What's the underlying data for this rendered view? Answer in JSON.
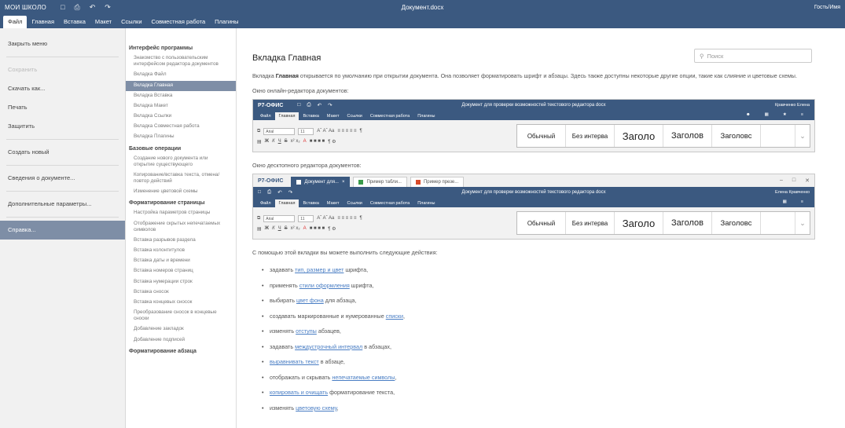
{
  "titlebar": {
    "app_name": "МОИ ШКОЛО",
    "doc_title": "Документ.docx",
    "user": "Гость/Имя"
  },
  "tabs": [
    "Файл",
    "Главная",
    "Вставка",
    "Макет",
    "Ссылки",
    "Совместная работа",
    "Плагины"
  ],
  "left_menu": [
    {
      "label": "Закрыть меню",
      "state": "normal"
    },
    {
      "label": "Сохранить",
      "state": "disabled"
    },
    {
      "label": "Скачать как...",
      "state": "normal"
    },
    {
      "label": "Печать",
      "state": "normal"
    },
    {
      "label": "Защитить",
      "state": "normal"
    },
    {
      "label": "Создать новый",
      "state": "normal"
    },
    {
      "label": "Сведения о документе...",
      "state": "normal"
    },
    {
      "label": "Дополнительные параметры...",
      "state": "normal"
    },
    {
      "label": "Справка...",
      "state": "active"
    }
  ],
  "toc": {
    "sections": [
      {
        "title": "Интерфейс программы",
        "items": [
          {
            "label": "Знакомство с пользовательским интерфейсом редактора документов",
            "active": false
          },
          {
            "label": "Вкладка Файл",
            "active": false
          },
          {
            "label": "Вкладка Главная",
            "active": true
          },
          {
            "label": "Вкладка Вставка",
            "active": false
          },
          {
            "label": "Вкладка Макет",
            "active": false
          },
          {
            "label": "Вкладка Ссылки",
            "active": false
          },
          {
            "label": "Вкладка Совместная работа",
            "active": false
          },
          {
            "label": "Вкладка Плагины",
            "active": false
          }
        ]
      },
      {
        "title": "Базовые операции",
        "items": [
          {
            "label": "Создание нового документа или открытие существующего",
            "active": false
          },
          {
            "label": "Копирование/вставка текста, отмена/повтор действий",
            "active": false
          },
          {
            "label": "Изменение цветовой схемы",
            "active": false
          }
        ]
      },
      {
        "title": "Форматирование страницы",
        "items": [
          {
            "label": "Настройка параметров страницы",
            "active": false
          },
          {
            "label": "Отображение скрытых непечатаемых символов",
            "active": false
          },
          {
            "label": "Вставка разрывов раздела",
            "active": false
          },
          {
            "label": "Вставка колонтитулов",
            "active": false
          },
          {
            "label": "Вставка даты и времени",
            "active": false
          },
          {
            "label": "Вставка номеров страниц",
            "active": false
          },
          {
            "label": "Вставка нумерации строк",
            "active": false
          },
          {
            "label": "Вставка сносок",
            "active": false
          },
          {
            "label": "Вставка концевых сносок",
            "active": false
          },
          {
            "label": "Преобразование сносок в концевые сноски",
            "active": false
          },
          {
            "label": "Добавление закладок",
            "active": false
          },
          {
            "label": "Добавление подписей",
            "active": false
          }
        ]
      },
      {
        "title": "Форматирование абзаца",
        "items": []
      }
    ]
  },
  "search": {
    "placeholder": "Поиск"
  },
  "article": {
    "title": "Вкладка Главная",
    "intro_before": "Вкладка ",
    "intro_bold": "Главная",
    "intro_after": " открывается по умолчанию при открытии документа. Она позволяет форматировать шрифт и абзацы. Здесь также доступны некоторые другие опции, такие как слияние и цветовые схемы.",
    "online_caption": "Окно онлайн-редактора документов:",
    "desktop_caption": "Окно десктопного редактора документов:",
    "actions_intro": "С помощью этой вкладки вы можете выполнить следующие действия:",
    "actions": [
      {
        "pre": "задавать ",
        "link": "тип, размер и цвет",
        "post": " шрифта,"
      },
      {
        "pre": "применять ",
        "link": "стили оформления",
        "post": " шрифта,"
      },
      {
        "pre": "выбирать ",
        "link": "цвет фона",
        "post": " для абзаца,"
      },
      {
        "pre": "создавать маркированные и нумерованные ",
        "link": "списки",
        "post": ","
      },
      {
        "pre": "изменять ",
        "link": "отступы",
        "post": " абзацев,"
      },
      {
        "pre": "задавать ",
        "link": "междустрочный интервал",
        "post": " в абзацах,"
      },
      {
        "pre": "",
        "link": "выравнивать текст",
        "post": " в абзаце,"
      },
      {
        "pre": "отображать и скрывать ",
        "link": "непечатаемые символы",
        "post": ","
      },
      {
        "pre": "",
        "link": "копировать и очищать",
        "post": " форматирование текста,"
      },
      {
        "pre": "изменять ",
        "link": "цветовую схему",
        "post": ","
      }
    ]
  },
  "online_shot": {
    "logo": "Р7-ОФИС",
    "title": "Документ для проверки возможностей текстового редактора docx",
    "user": "Кравченко Елена",
    "tabs": [
      "Файл",
      "Главная",
      "Вставка",
      "Макет",
      "Ссылки",
      "Совместная работа",
      "Плагины"
    ],
    "font": "Arial",
    "size": "11",
    "styles": [
      "Обычный",
      "Без интерва",
      "Заголо",
      "Заголов",
      "Заголовс"
    ]
  },
  "desktop_shot": {
    "logo": "Р7-ОФИС",
    "doc_tabs": [
      "Документ для...",
      "Пример табли...",
      "Пример презе..."
    ],
    "title": "Документ для проверки возможностей текстового редактора docx",
    "user": "Елена Кравченко",
    "tabs": [
      "Файл",
      "Главная",
      "Вставка",
      "Макет",
      "Ссылки",
      "Совместная работа",
      "Плагины"
    ],
    "font": "Arial",
    "size": "11",
    "styles": [
      "Обычный",
      "Без интерва",
      "Заголо",
      "Заголов",
      "Заголовс"
    ]
  },
  "colors": {
    "header": "#3b5980",
    "active_item": "#7e8ea6",
    "link": "#4a7ec4"
  }
}
